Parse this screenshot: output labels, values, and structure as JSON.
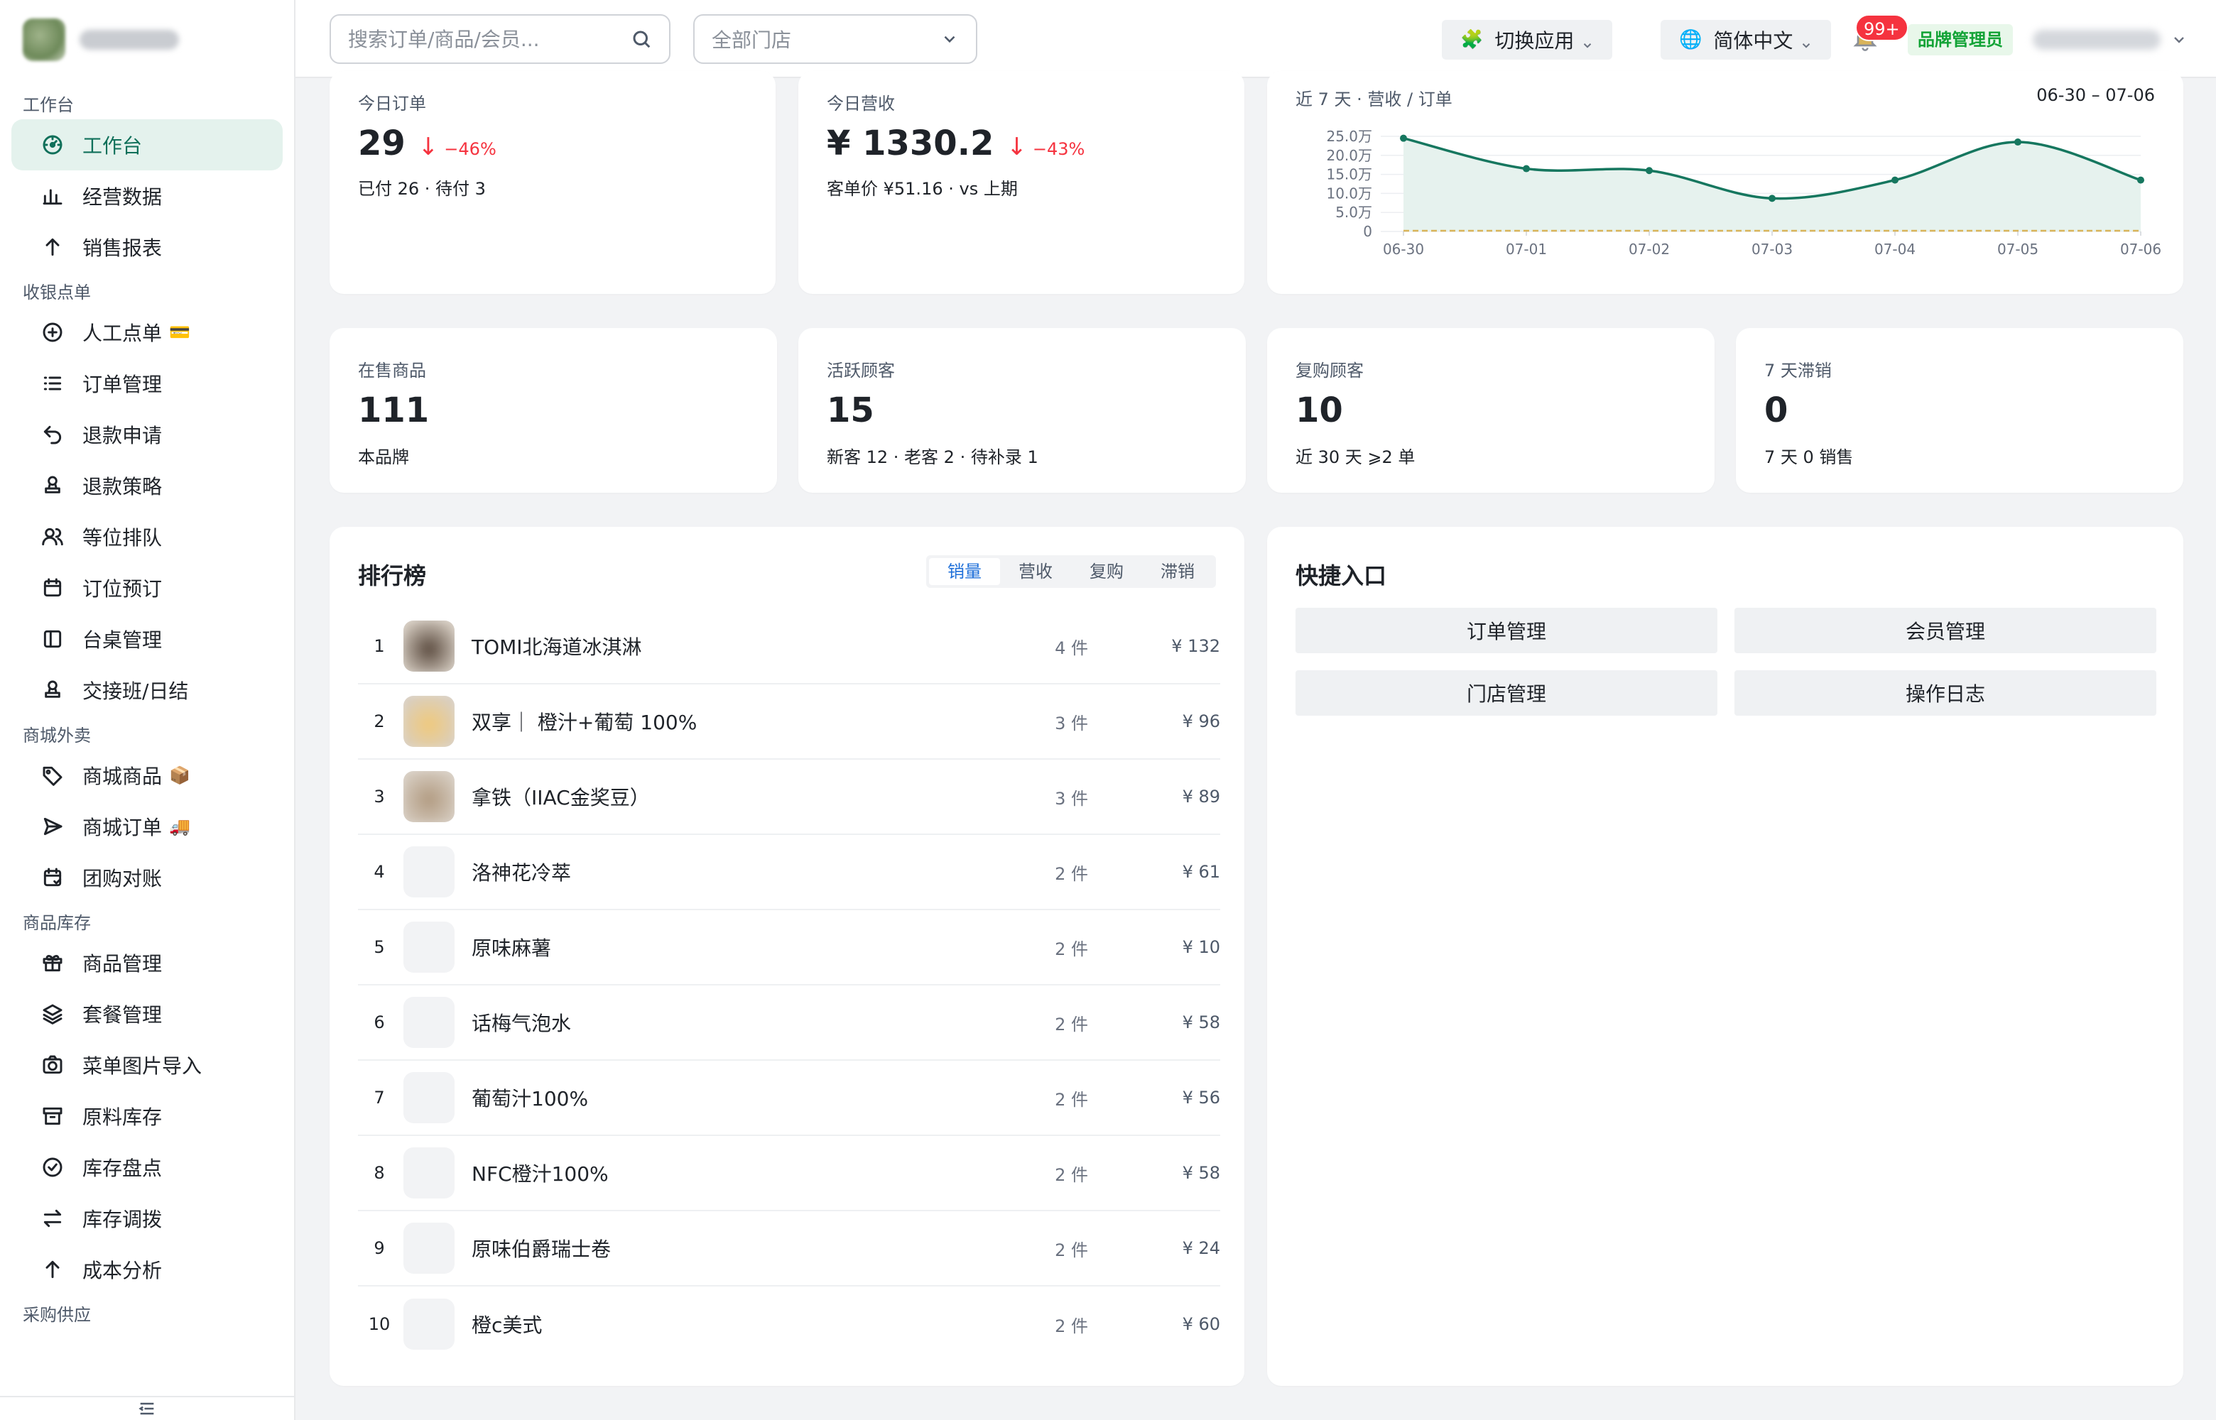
{
  "search": {
    "placeholder": "搜索订单/商品/会员..."
  },
  "store_select": {
    "value": "全部门店"
  },
  "topbar": {
    "switch_app": "切换应用",
    "language": "简体中文",
    "notification_count": "99+",
    "role": "品牌管理员"
  },
  "sidebar": {
    "groups": [
      {
        "title": "工作台",
        "items": [
          {
            "label": "工作台",
            "icon": "dashboard-icon",
            "active": true
          },
          {
            "label": "经营数据",
            "icon": "bar-chart-icon"
          },
          {
            "label": "销售报表",
            "icon": "arrow-up-icon"
          }
        ]
      },
      {
        "title": "收银点单",
        "items": [
          {
            "label": "人工点单",
            "icon": "plus-circle-icon",
            "emoji": "💳"
          },
          {
            "label": "订单管理",
            "icon": "list-icon"
          },
          {
            "label": "退款申请",
            "icon": "undo-icon"
          },
          {
            "label": "退款策略",
            "icon": "stamp-icon"
          },
          {
            "label": "等位排队",
            "icon": "users-icon"
          },
          {
            "label": "订位预订",
            "icon": "calendar-icon"
          },
          {
            "label": "台桌管理",
            "icon": "layout-icon"
          },
          {
            "label": "交接班/日结",
            "icon": "stamp-icon"
          }
        ]
      },
      {
        "title": "商城外卖",
        "items": [
          {
            "label": "商城商品",
            "icon": "tag-icon",
            "emoji": "📦"
          },
          {
            "label": "商城订单",
            "icon": "send-icon",
            "emoji": "🚚"
          },
          {
            "label": "团购对账",
            "icon": "calendar-check-icon"
          }
        ]
      },
      {
        "title": "商品库存",
        "items": [
          {
            "label": "商品管理",
            "icon": "gift-icon"
          },
          {
            "label": "套餐管理",
            "icon": "layers-icon"
          },
          {
            "label": "菜单图片导入",
            "icon": "camera-icon"
          },
          {
            "label": "原料库存",
            "icon": "archive-icon"
          },
          {
            "label": "库存盘点",
            "icon": "check-circle-icon"
          },
          {
            "label": "库存调拨",
            "icon": "transfer-icon"
          },
          {
            "label": "成本分析",
            "icon": "arrow-up-icon"
          }
        ]
      },
      {
        "title": "采购供应",
        "items": []
      }
    ]
  },
  "stats_top": {
    "orders": {
      "label": "今日订单",
      "value": "29",
      "delta": "−46%",
      "sub": "已付 26 · 待付 3"
    },
    "revenue": {
      "label": "今日营收",
      "value": "¥ 1330.2",
      "delta": "−43%",
      "sub": "客单价 ¥51.16 · vs 上期"
    }
  },
  "chart_title": "近 7 天 · 营收 / 订单",
  "chart_range": "06-30 – 07-06",
  "chart_data": {
    "type": "line",
    "categories": [
      "06-30",
      "07-01",
      "07-02",
      "07-03",
      "07-04",
      "07-05",
      "07-06"
    ],
    "y_tick_labels": [
      "0",
      "5.0万",
      "10.0万",
      "15.0万",
      "20.0万",
      "25.0万"
    ],
    "ylim": [
      0,
      25
    ],
    "grid": true,
    "series": [
      {
        "values": [
          24.5,
          16.5,
          16.0,
          8.7,
          13.5,
          23.5,
          13.5
        ],
        "color": "#16775f",
        "fill": "#e6f2ee"
      },
      {
        "values": [
          0,
          0,
          0,
          0,
          0,
          0,
          0
        ],
        "color": "#d9b45a"
      }
    ]
  },
  "stats_bottom": [
    {
      "label": "在售商品",
      "value": "111",
      "sub": "本品牌"
    },
    {
      "label": "活跃顾客",
      "value": "15",
      "sub": "新客 12 · 老客 2 · 待补录 1"
    },
    {
      "label": "复购顾客",
      "value": "10",
      "sub": "近 30 天 ⩾2 单"
    },
    {
      "label": "7 天滞销",
      "value": "0",
      "sub": "7 天 0 销售"
    }
  ],
  "ranking": {
    "title": "排行榜",
    "tabs": [
      "销量",
      "营收",
      "复购",
      "滞销"
    ],
    "active_tab": "销量",
    "rows": [
      {
        "rank": "1",
        "name": "TOMI北海道冰淇淋",
        "qty": "4 件",
        "amount": "¥ 132",
        "thumb": "#5a4a3e"
      },
      {
        "rank": "2",
        "name": "双享｜ 橙汁+葡萄 100%",
        "qty": "3 件",
        "amount": "¥ 96",
        "thumb": "#f0c97a"
      },
      {
        "rank": "3",
        "name": "拿铁（IIAC金奖豆）",
        "qty": "3 件",
        "amount": "¥ 89",
        "thumb": "#b19a80"
      },
      {
        "rank": "4",
        "name": "洛神花冷萃",
        "qty": "2 件",
        "amount": "¥ 61",
        "thumb": ""
      },
      {
        "rank": "5",
        "name": "原味麻薯",
        "qty": "2 件",
        "amount": "¥ 10",
        "thumb": ""
      },
      {
        "rank": "6",
        "name": "话梅气泡水",
        "qty": "2 件",
        "amount": "¥ 58",
        "thumb": ""
      },
      {
        "rank": "7",
        "name": "葡萄汁100%",
        "qty": "2 件",
        "amount": "¥ 56",
        "thumb": ""
      },
      {
        "rank": "8",
        "name": "NFC橙汁100%",
        "qty": "2 件",
        "amount": "¥ 58",
        "thumb": ""
      },
      {
        "rank": "9",
        "name": "原味伯爵瑞士卷",
        "qty": "2 件",
        "amount": "¥ 24",
        "thumb": ""
      },
      {
        "rank": "10",
        "name": "橙c美式",
        "qty": "2 件",
        "amount": "¥ 60",
        "thumb": ""
      }
    ]
  },
  "quick": {
    "title": "快捷入口",
    "buttons": [
      "订单管理",
      "会员管理",
      "门店管理",
      "操作日志"
    ]
  }
}
